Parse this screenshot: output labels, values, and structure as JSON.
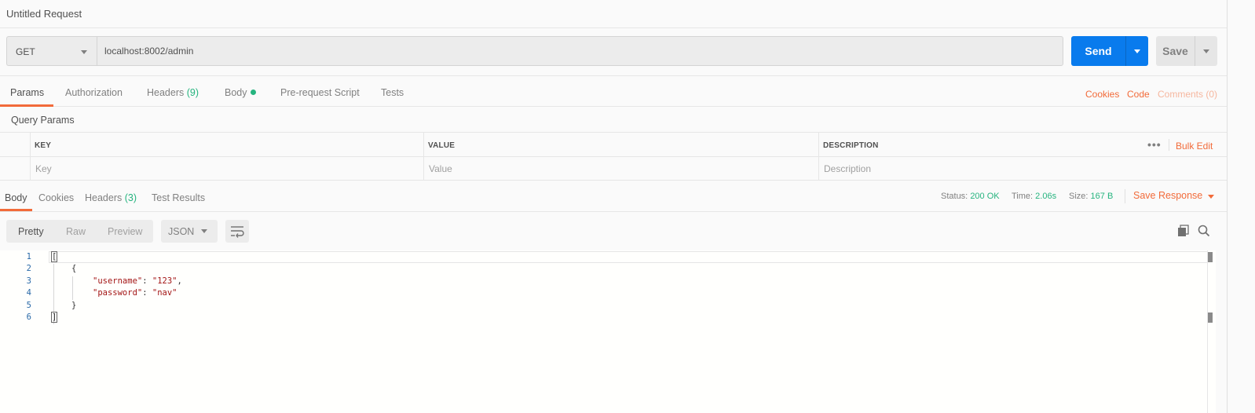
{
  "window": {
    "title": "Untitled Request"
  },
  "request": {
    "method": "GET",
    "url": "localhost:8002/admin",
    "send_label": "Send",
    "save_label": "Save"
  },
  "request_tabs": {
    "params": "Params",
    "authorization": "Authorization",
    "headers": "Headers",
    "headers_count": "(9)",
    "body": "Body",
    "pre_request": "Pre-request Script",
    "tests": "Tests",
    "cookies": "Cookies",
    "code": "Code",
    "comments": "Comments (0)"
  },
  "query_params": {
    "title": "Query Params",
    "columns": {
      "key": "KEY",
      "value": "VALUE",
      "description": "DESCRIPTION"
    },
    "placeholders": {
      "key": "Key",
      "value": "Value",
      "description": "Description"
    },
    "bulk_edit": "Bulk Edit",
    "more": "•••"
  },
  "response_tabs": {
    "body": "Body",
    "cookies": "Cookies",
    "headers": "Headers",
    "headers_count": "(3)",
    "test_results": "Test Results"
  },
  "response_status": {
    "status_label": "Status:",
    "status_value": "200 OK",
    "time_label": "Time:",
    "time_value": "2.06s",
    "size_label": "Size:",
    "size_value": "167 B",
    "save_response": "Save Response"
  },
  "body_toolbar": {
    "pretty": "Pretty",
    "raw": "Raw",
    "preview": "Preview",
    "format": "JSON"
  },
  "editor": {
    "line_numbers": [
      "1",
      "2",
      "3",
      "4",
      "5",
      "6"
    ],
    "lines": {
      "l1": "[",
      "l2": "{",
      "l3_key": "\"username\"",
      "l3_sep": ": ",
      "l3_val": "\"123\"",
      "l3_end": ",",
      "l4_key": "\"password\"",
      "l4_sep": ": ",
      "l4_val": "\"nav\"",
      "l5": "}",
      "l6": "]"
    }
  },
  "icons": {
    "copy": "copy-icon",
    "search": "search-icon",
    "wrap": "wrap-lines-icon"
  },
  "colors": {
    "accent": "#f26b3a",
    "send": "#097bed",
    "success": "#26b47f"
  }
}
